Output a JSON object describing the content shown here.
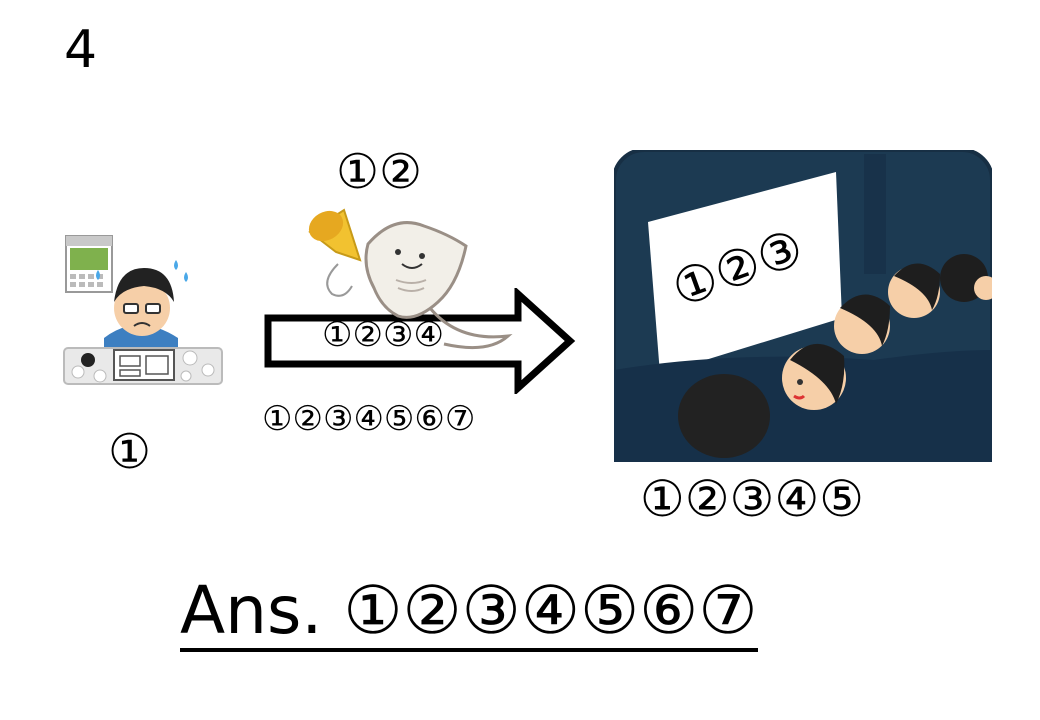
{
  "problem_number": "4",
  "labels": {
    "left": "①",
    "top": "①②",
    "arrow": "①②③④",
    "under_arrow": "①②③④⑤⑥⑦",
    "screen": "①②③",
    "right": "①②③④⑤"
  },
  "answer": "Ans. ①②③④⑤⑥⑦",
  "icons": {
    "left": "worried-artist-at-desk-icon",
    "arrow_character": "stingray-with-megaphone-icon",
    "right": "movie-theater-audience-icon"
  },
  "colors": {
    "theater_bg": "#1c3a52",
    "screen": "#ffffff",
    "megaphone": "#f2c230"
  }
}
